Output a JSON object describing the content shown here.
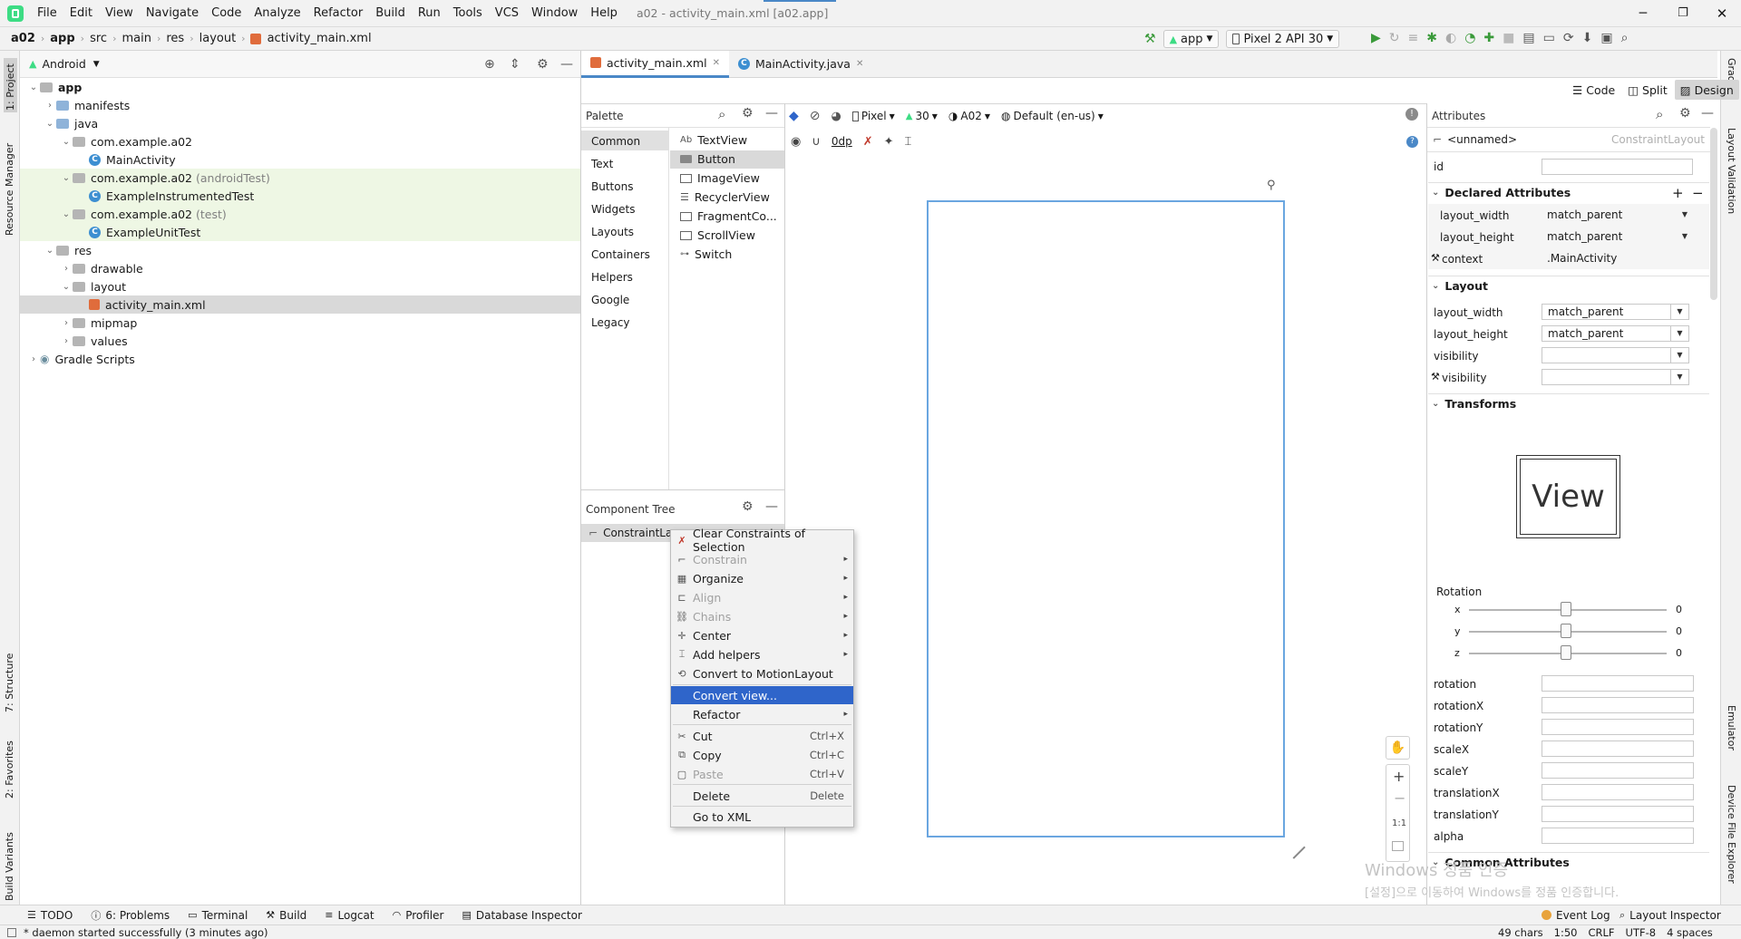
{
  "window": {
    "title": "a02 - activity_main.xml [a02.app]"
  },
  "menu": [
    "File",
    "Edit",
    "View",
    "Navigate",
    "Code",
    "Analyze",
    "Refactor",
    "Build",
    "Run",
    "Tools",
    "VCS",
    "Window",
    "Help"
  ],
  "breadcrumb": [
    "a02",
    "app",
    "src",
    "main",
    "res",
    "layout",
    "activity_main.xml"
  ],
  "toolbar": {
    "run_config": "app",
    "device": "Pixel 2 API 30"
  },
  "left_strip": {
    "project": "1: Project",
    "resource_manager": "Resource Manager",
    "structure": "7: Structure",
    "favorites": "2: Favorites",
    "build_variants": "Build Variants"
  },
  "right_strip": {
    "gradle": "Gradle",
    "layout_validation": "Layout Validation",
    "emulator": "Emulator",
    "device_file_explorer": "Device File Explorer"
  },
  "project": {
    "view": "Android",
    "tree": [
      {
        "label": "app",
        "bold": true
      },
      {
        "label": "manifests"
      },
      {
        "label": "java"
      },
      {
        "label": "com.example.a02"
      },
      {
        "label": "MainActivity"
      },
      {
        "label": "com.example.a02",
        "suffix": "(androidTest)"
      },
      {
        "label": "ExampleInstrumentedTest"
      },
      {
        "label": "com.example.a02",
        "suffix": "(test)"
      },
      {
        "label": "ExampleUnitTest"
      },
      {
        "label": "res"
      },
      {
        "label": "drawable"
      },
      {
        "label": "layout"
      },
      {
        "label": "activity_main.xml"
      },
      {
        "label": "mipmap"
      },
      {
        "label": "values"
      },
      {
        "label": "Gradle Scripts"
      }
    ]
  },
  "editor": {
    "tabs": [
      "activity_main.xml",
      "MainActivity.java"
    ],
    "modes": [
      "Code",
      "Split",
      "Design"
    ],
    "design_toolbar": {
      "device": "Pixel",
      "api": "30",
      "theme": "A02",
      "locale": "Default (en-us)",
      "margin": "0dp"
    }
  },
  "palette": {
    "title": "Palette",
    "categories": [
      "Common",
      "Text",
      "Buttons",
      "Widgets",
      "Layouts",
      "Containers",
      "Helpers",
      "Google",
      "Legacy"
    ],
    "items": [
      "TextView",
      "Button",
      "ImageView",
      "RecyclerView",
      "FragmentCo...",
      "ScrollView",
      "Switch"
    ]
  },
  "component_tree": {
    "title": "Component Tree",
    "root": "ConstraintLay"
  },
  "context_menu": {
    "items": [
      {
        "label": "Clear Constraints of Selection"
      },
      {
        "label": "Constrain",
        "sub": "▸"
      },
      {
        "label": "Organize",
        "sub": "▸"
      },
      {
        "label": "Align",
        "sub": "▸"
      },
      {
        "label": "Chains",
        "sub": "▸"
      },
      {
        "label": "Center",
        "sub": "▸"
      },
      {
        "label": "Add helpers",
        "sub": "▸"
      },
      {
        "label": "Convert to MotionLayout"
      },
      {
        "label": "Convert view..."
      },
      {
        "label": "Refactor",
        "sub": "▸"
      },
      {
        "label": "Cut",
        "shortcut": "Ctrl+X"
      },
      {
        "label": "Copy",
        "shortcut": "Ctrl+C"
      },
      {
        "label": "Paste",
        "shortcut": "Ctrl+V"
      },
      {
        "label": "Delete",
        "shortcut": "Delete"
      },
      {
        "label": "Go to XML"
      }
    ]
  },
  "zoom": {
    "one_to_one": "1:1"
  },
  "attributes": {
    "title": "Attributes",
    "component": "<unnamed>",
    "component_type": "ConstraintLayout",
    "id_label": "id",
    "declared_title": "Declared Attributes",
    "declared": [
      {
        "name": "layout_width",
        "value": "match_parent"
      },
      {
        "name": "layout_height",
        "value": "match_parent"
      },
      {
        "name": "context",
        "value": ".MainActivity"
      }
    ],
    "layout_title": "Layout",
    "layout": [
      {
        "name": "layout_width",
        "value": "match_parent"
      },
      {
        "name": "layout_height",
        "value": "match_parent"
      },
      {
        "name": "visibility",
        "value": ""
      },
      {
        "name": "visibility",
        "value": ""
      }
    ],
    "transforms_title": "Transforms",
    "view_preview": "View",
    "rotation_label": "Rotation",
    "rotation_axes": [
      {
        "axis": "x",
        "value": "0"
      },
      {
        "axis": "y",
        "value": "0"
      },
      {
        "axis": "z",
        "value": "0"
      }
    ],
    "transform_fields": [
      "rotation",
      "rotationX",
      "rotationY",
      "scaleX",
      "scaleY",
      "translationX",
      "translationY",
      "alpha"
    ],
    "common_title": "Common Attributes"
  },
  "watermark": {
    "line1": "Windows 정품 인증",
    "line2": "[설정]으로 이동하여 Windows를 정품 인증합니다."
  },
  "bottom_tools": [
    "TODO",
    "6: Problems",
    "Terminal",
    "Build",
    "Logcat",
    "Profiler",
    "Database Inspector"
  ],
  "bottom_right_tools": [
    "Event Log",
    "Layout Inspector"
  ],
  "status": {
    "message": "* daemon started successfully (3 minutes ago)",
    "chars": "49 chars",
    "position": "1:50",
    "line_sep": "CRLF",
    "encoding": "UTF-8",
    "indent": "4 spaces"
  }
}
